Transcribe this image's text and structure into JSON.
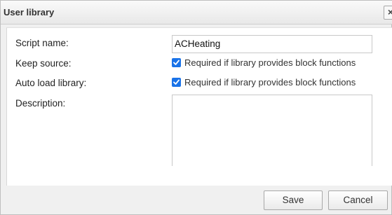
{
  "dialog": {
    "title": "User library",
    "close_glyph": "×",
    "close_icon": "close-icon"
  },
  "form": {
    "script_name": {
      "label": "Script name:",
      "value": "ACHeating"
    },
    "keep_source": {
      "label": "Keep source:",
      "checked": true,
      "hint": "Required if library provides block functions"
    },
    "auto_load": {
      "label": "Auto load library:",
      "checked": true,
      "hint": "Required if library provides block functions"
    },
    "description": {
      "label": "Description:",
      "value": ""
    }
  },
  "buttons": {
    "save": "Save",
    "cancel": "Cancel"
  },
  "colors": {
    "checkbox_accent": "#1a73e8"
  }
}
